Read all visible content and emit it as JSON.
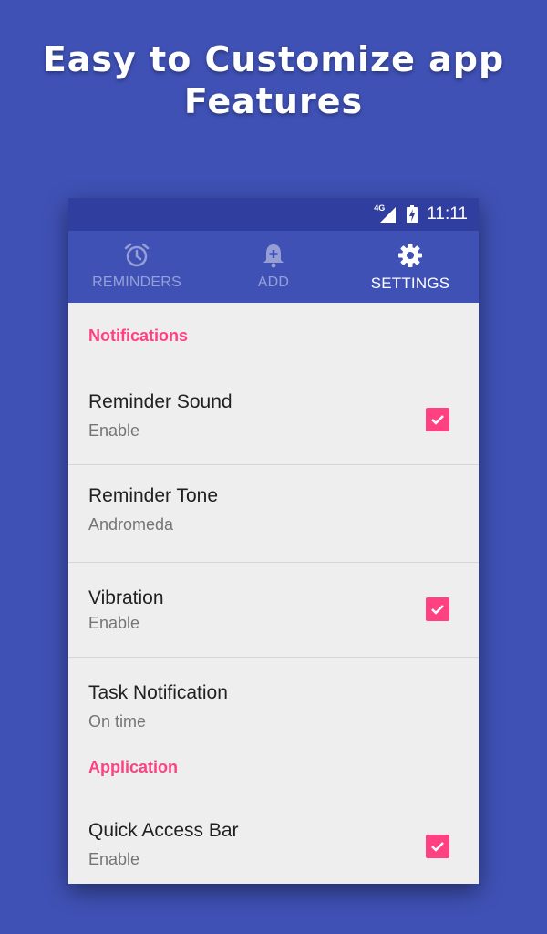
{
  "promo": {
    "headline_line1": "Easy to Customize app",
    "headline_line2": "Features"
  },
  "status_bar": {
    "network": "4G",
    "time": "11:11"
  },
  "tabs": [
    {
      "label": "REMINDERS",
      "icon": "alarm-clock-icon",
      "active": false
    },
    {
      "label": "ADD",
      "icon": "bell-plus-icon",
      "active": false
    },
    {
      "label": "SETTINGS",
      "icon": "gear-icon",
      "active": true
    }
  ],
  "settings": {
    "notifications_header": "Notifications",
    "reminder_sound": {
      "title": "Reminder Sound",
      "summary": "Enable",
      "checked": true
    },
    "reminder_tone": {
      "title": "Reminder Tone",
      "summary": "Andromeda"
    },
    "vibration": {
      "title": "Vibration",
      "summary": "Enable",
      "checked": true
    },
    "task_notification": {
      "title": "Task Notification",
      "summary": "On time"
    },
    "application_header": "Application",
    "quick_access_bar": {
      "title": "Quick Access Bar",
      "summary": "Enable",
      "checked": true
    }
  },
  "colors": {
    "background": "#3f51b5",
    "status_bar": "#303f9f",
    "accent": "#ff4081",
    "content_bg": "#eeeeee"
  }
}
